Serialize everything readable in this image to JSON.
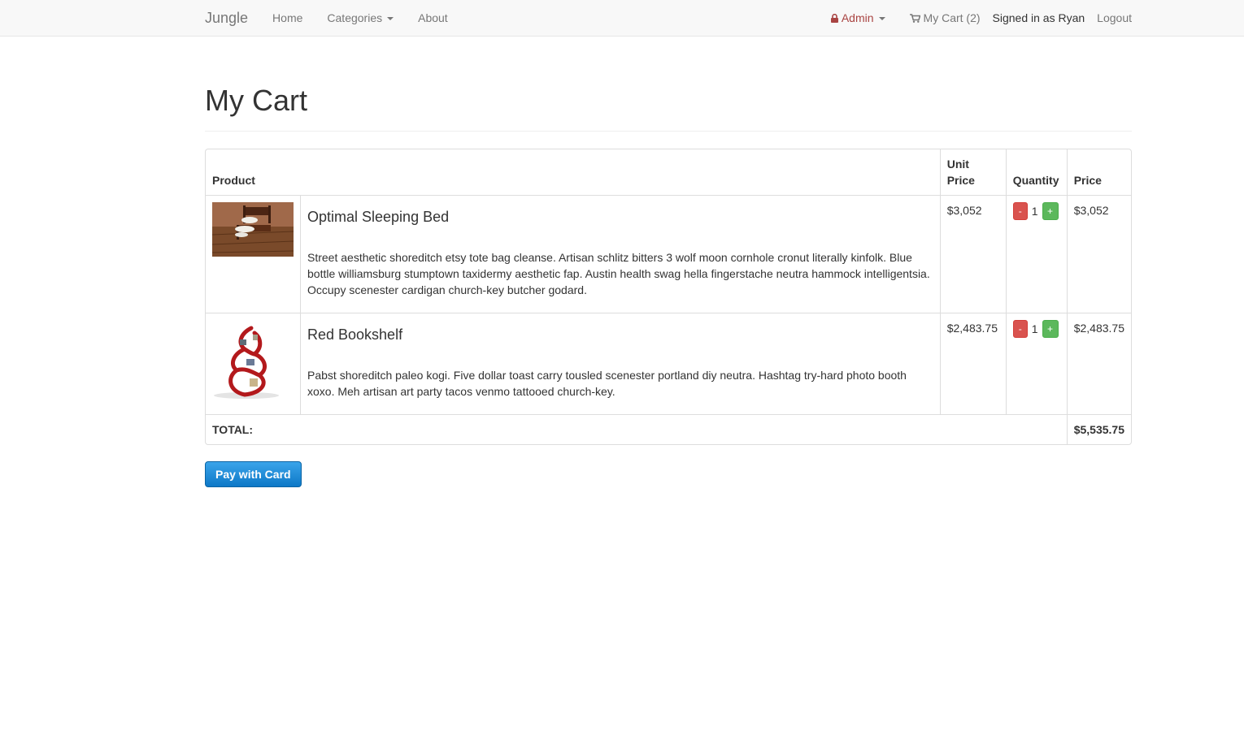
{
  "nav": {
    "brand": "Jungle",
    "home": "Home",
    "categories": "Categories",
    "about": "About",
    "admin": "Admin",
    "cart": "My Cart (2)",
    "signed_in": "Signed in as Ryan",
    "logout": "Logout"
  },
  "page": {
    "title": "My Cart"
  },
  "table": {
    "headers": {
      "product": "Product",
      "unit_price": "Unit Price",
      "quantity": "Quantity",
      "price": "Price"
    },
    "rows": [
      {
        "name": "Optimal Sleeping Bed",
        "description": "Street aesthetic shoreditch etsy tote bag cleanse. Artisan schlitz bitters 3 wolf moon cornhole cronut literally kinfolk. Blue bottle williamsburg stumptown taxidermy aesthetic fap. Austin health swag hella fingerstache neutra hammock intelligentsia. Occupy scenester cardigan church-key butcher godard.",
        "unit_price": "$3,052",
        "quantity": "1",
        "price": "$3,052",
        "minus": "-",
        "plus": "+"
      },
      {
        "name": "Red Bookshelf",
        "description": "Pabst shoreditch paleo kogi. Five dollar toast carry tousled scenester portland diy neutra. Hashtag try-hard photo booth xoxo. Meh artisan art party tacos venmo tattooed church-key.",
        "unit_price": "$2,483.75",
        "quantity": "1",
        "price": "$2,483.75",
        "minus": "-",
        "plus": "+"
      }
    ],
    "total_label": "TOTAL:",
    "total_value": "$5,535.75"
  },
  "actions": {
    "pay": "Pay with Card"
  },
  "colors": {
    "admin": "#a94442",
    "minus": "#d9534f",
    "plus": "#5cb85c",
    "pay": "#1a8ad8"
  },
  "icons": {
    "admin": "lock-icon",
    "cart": "cart-icon"
  }
}
